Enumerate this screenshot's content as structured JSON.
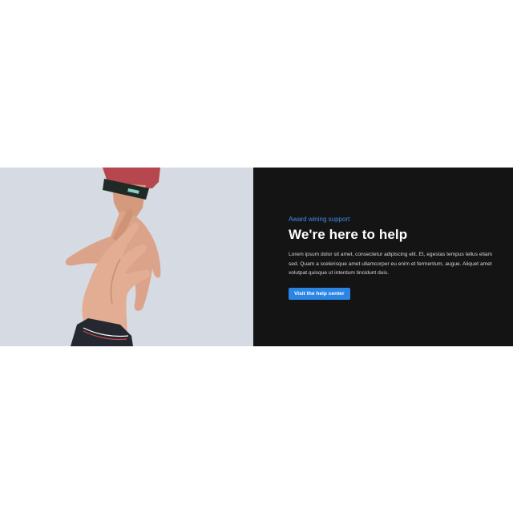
{
  "hero": {
    "eyebrow": "Award wining support",
    "title": "We're here to help",
    "body": "Lorem ipsum dolor sit amet, consectetur adipiscing elit. Et, egestas tempus tellus etiam sed. Quam a scelerisque amet ullamcorper eu enim et fermentum, augue. Aliquet amet volutpat quisque ut interdum tincidunt duis.",
    "cta_label": "Visit the help center",
    "image_subject": "hands-reaching-photo"
  },
  "colors": {
    "accent": "#2a85e4",
    "eyebrow": "#3b8fe8",
    "panel_background": "#141414",
    "photo_background": "#d6dae3"
  }
}
